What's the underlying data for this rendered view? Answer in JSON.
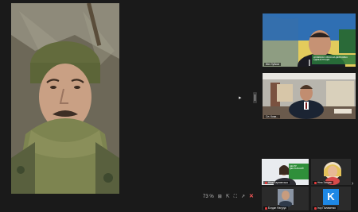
{
  "participants": {
    "top_right": {
      "name": "Ивл Зубков",
      "banner": "ДОНЕЦЬКА ОБЛАСНА ДЕРЖАВНА АДМІНІСТРАЦІЯ"
    },
    "mid_right": {
      "name": "Ол. Кова..."
    },
    "thumbs": [
      {
        "name": "Ніна Барвинська",
        "banner": "ЦЕНТР ДЕНТАЛЬНИЙ"
      },
      {
        "name": "Ніна Запрас"
      },
      {
        "name": "Богдан Нагурук"
      },
      {
        "name": "Ігор Паламенко",
        "avatar_letter": "K"
      }
    ]
  },
  "toolbar": {
    "items": [
      "73 %",
      "⊞",
      "⇱",
      "⛶",
      "↗"
    ],
    "close": "✕"
  },
  "colors": {
    "accent_blue": "#1e88e5",
    "mic_red": "#e23b3b"
  }
}
